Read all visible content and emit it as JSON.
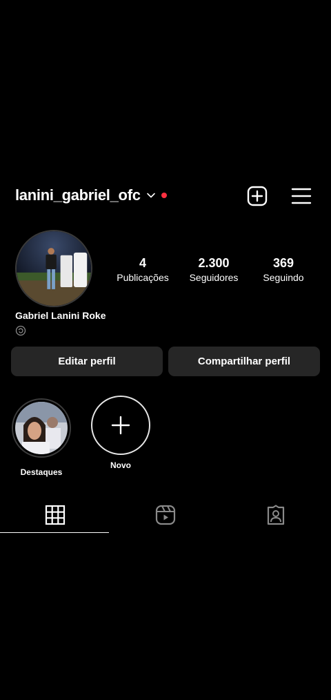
{
  "header": {
    "username": "lanini_gabriel_ofc",
    "add_icon": "plus-square-icon",
    "menu_icon": "hamburger-menu-icon",
    "notification_dot_color": "#ff3040"
  },
  "profile": {
    "full_name": "Gabriel Lanini Roke",
    "stats": [
      {
        "value": "4",
        "label": "Publicações"
      },
      {
        "value": "2.300",
        "label": "Seguidores"
      },
      {
        "value": "369",
        "label": "Seguindo"
      }
    ]
  },
  "actions": {
    "edit_label": "Editar perfil",
    "share_label": "Compartilhar perfil"
  },
  "highlights": [
    {
      "label": "Destaques"
    },
    {
      "label": "Novo"
    }
  ],
  "tabs": [
    {
      "name": "grid",
      "icon": "grid-icon",
      "active": true
    },
    {
      "name": "reels",
      "icon": "reels-icon",
      "active": false
    },
    {
      "name": "tagged",
      "icon": "tagged-icon",
      "active": false
    }
  ],
  "colors": {
    "background": "#000000",
    "button_bg": "#262626",
    "text": "#ffffff"
  }
}
